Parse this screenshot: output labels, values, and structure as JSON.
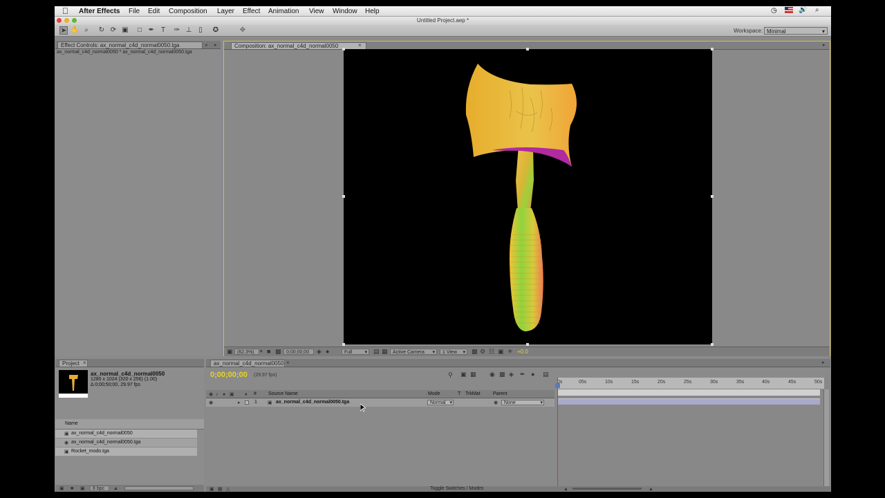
{
  "menubar": {
    "apple": "",
    "app_name": "After Effects",
    "menus": [
      "File",
      "Edit",
      "Composition",
      "Layer",
      "Effect",
      "Animation",
      "View",
      "Window",
      "Help"
    ]
  },
  "window": {
    "title": "Untitled Project.aep *"
  },
  "workspace": {
    "label": "Workspace:",
    "value": "Minimal"
  },
  "effect_controls": {
    "tab": "Effect Controls: ax_normal_c4d_normal0050.tga",
    "subtitle": "ax_normal_c4d_normal0050 * ax_normal_c4d_normal0050.tga"
  },
  "composition": {
    "tab": "Composition: ax_normal_c4d_normal0050",
    "zoom": "(62.3%)",
    "timecode": "0;00;00;00",
    "resolution": "Full",
    "camera": "Active Camera",
    "views": "1 View",
    "exposure": "+0.0"
  },
  "project": {
    "tab": "Project",
    "item_name": "ax_normal_c4d_normal0050",
    "item_dims": "1280 x 1024  (320 x 256) (1.00)",
    "item_duration": "Δ 0;00;50;00, 29.97 fps",
    "column_name": "Name",
    "items": [
      "ax_normal_c4d_normal0050",
      "ax_normal_c4d_normal0050.tga",
      "Rocket_modo.tga"
    ],
    "bpc": "8 bpc"
  },
  "timeline": {
    "tab": "ax_normal_c4d_normal0050",
    "timecode": "0;00;00;00",
    "fps": "(29.97 fps)",
    "col_num": "#",
    "col_source": "Source Name",
    "col_mode": "Mode",
    "col_t": "T",
    "col_trkmat": "TrkMat",
    "col_parent": "Parent",
    "layer_num": "1",
    "layer_name": "ax_normal_c4d_normal0050.tga",
    "layer_mode": "Normal",
    "layer_parent": "None",
    "ruler": [
      "0s",
      "05s",
      "10s",
      "15s",
      "20s",
      "25s",
      "30s",
      "35s",
      "40s",
      "45s",
      "50s"
    ],
    "toggle_label": "Toggle Switches / Modes"
  },
  "colors": {
    "accent_yellow": "#d8c13a",
    "timecode_yellow": "#e8d22a",
    "playhead_red": "#c83a2a",
    "layer_bar": "#a9a9c8"
  }
}
